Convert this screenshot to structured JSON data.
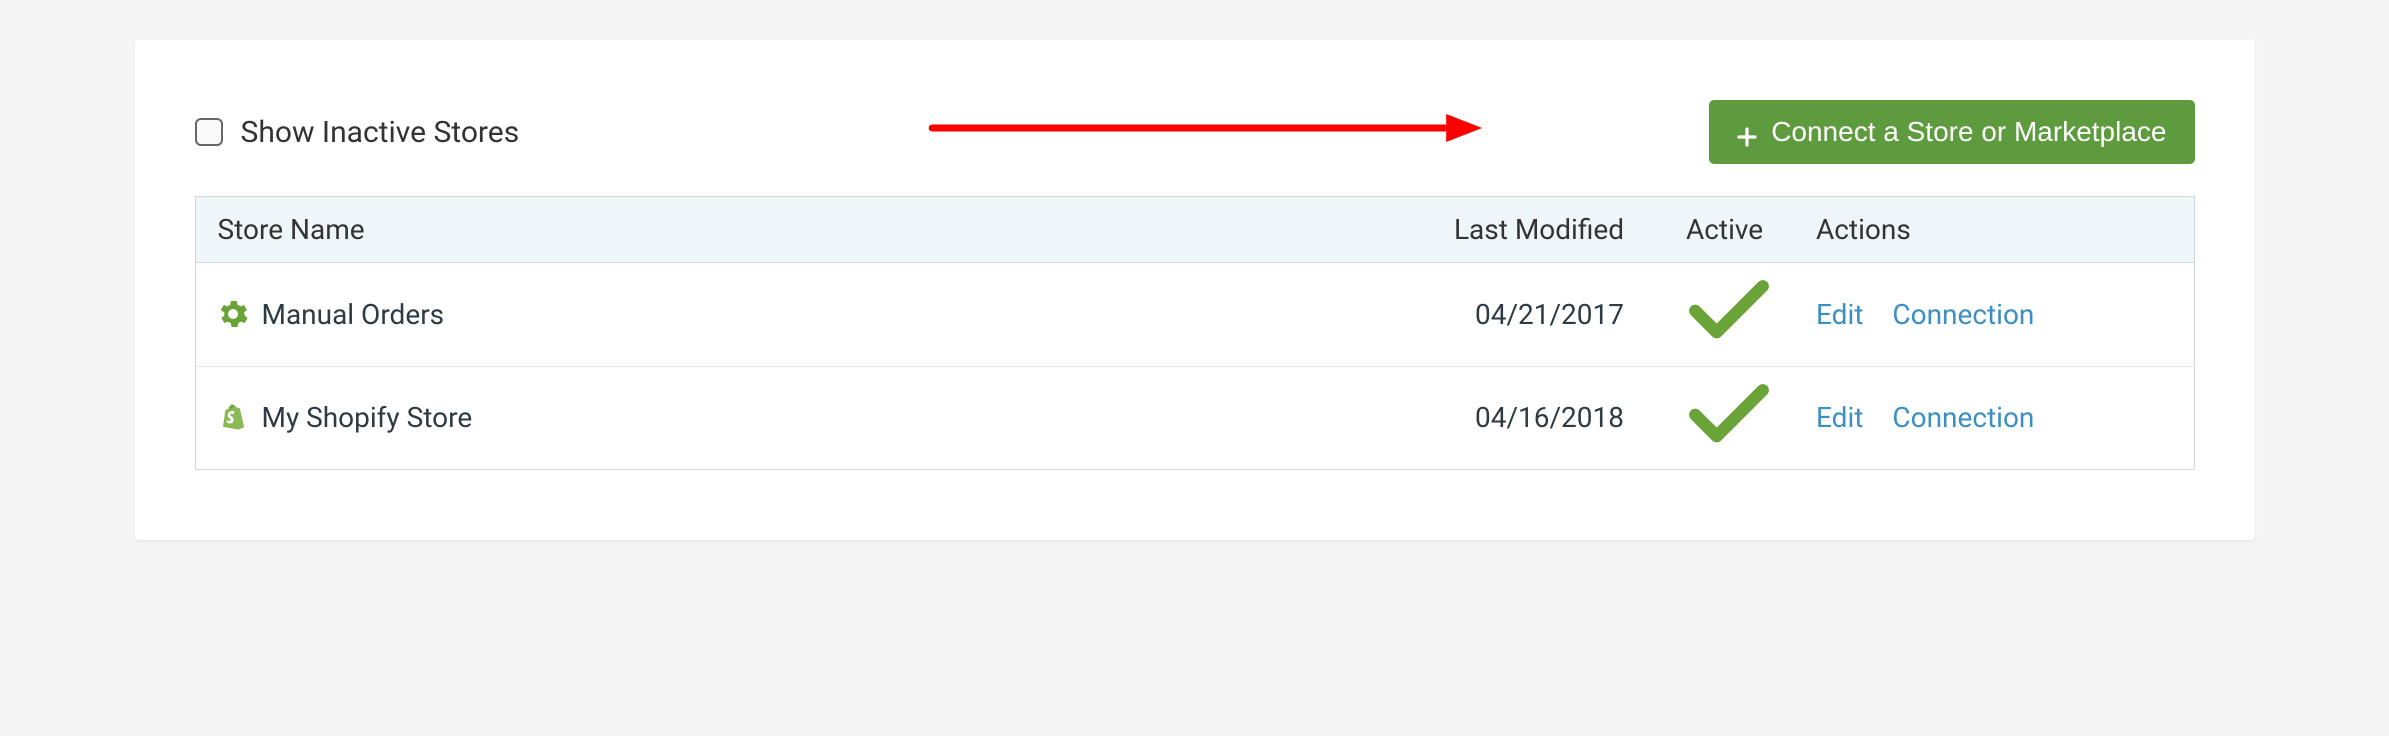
{
  "controls": {
    "show_inactive_label": "Show Inactive Stores",
    "connect_button_label": "Connect a Store or Marketplace"
  },
  "table": {
    "headers": {
      "store_name": "Store Name",
      "last_modified": "Last Modified",
      "active": "Active",
      "actions": "Actions"
    },
    "rows": [
      {
        "icon": "gear",
        "name": "Manual Orders",
        "last_modified": "04/21/2017",
        "active": true,
        "actions": {
          "edit": "Edit",
          "connection": "Connection"
        }
      },
      {
        "icon": "shopify",
        "name": "My Shopify Store",
        "last_modified": "04/16/2018",
        "active": true,
        "actions": {
          "edit": "Edit",
          "connection": "Connection"
        }
      }
    ]
  },
  "colors": {
    "primary_green": "#5e9b3f",
    "link_blue": "#3b8fc2",
    "header_bg": "#eef6fa",
    "arrow_red": "#ff0000"
  }
}
